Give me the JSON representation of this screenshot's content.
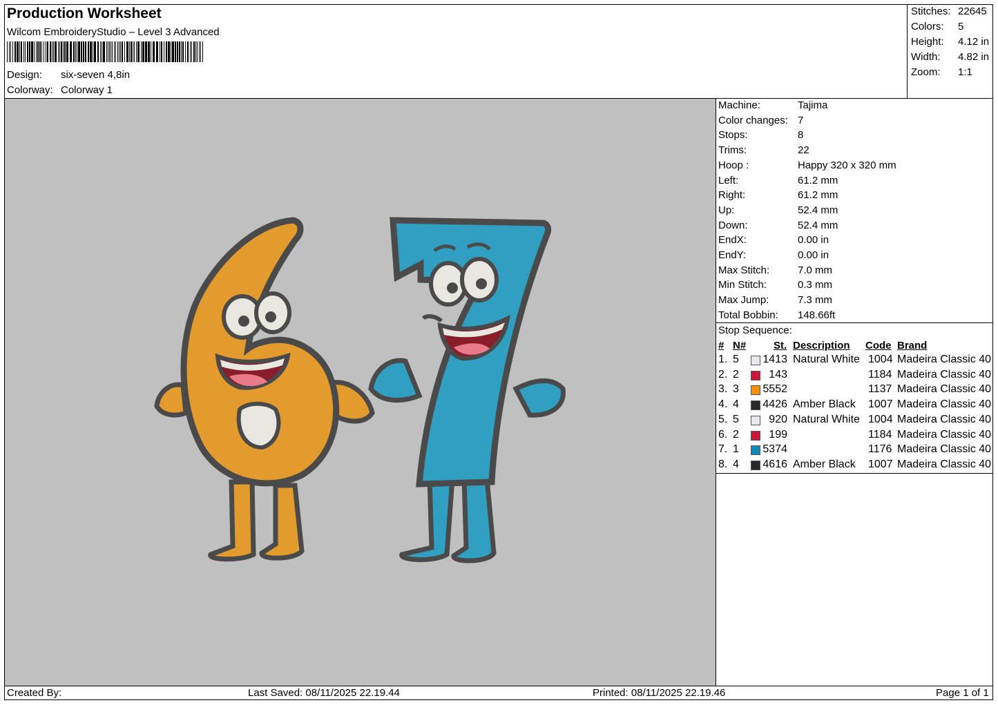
{
  "header": {
    "title": "Production Worksheet",
    "software": "Wilcom EmbroideryStudio – Level 3 Advanced",
    "design_label": "Design:",
    "design_value": "six-seven 4,8in",
    "colorway_label": "Colorway:",
    "colorway_value": "Colorway 1"
  },
  "summary": {
    "stitches_label": "Stitches:",
    "stitches_value": "22645",
    "colors_label": "Colors:",
    "colors_value": "5",
    "height_label": "Height:",
    "height_value": "4.12 in",
    "width_label": "Width:",
    "width_value": "4.82 in",
    "zoom_label": "Zoom:",
    "zoom_value": "1:1"
  },
  "machine_info": [
    {
      "label": "Machine:",
      "value": "Tajima"
    },
    {
      "label": "Color changes:",
      "value": "7"
    },
    {
      "label": "Stops:",
      "value": "8"
    },
    {
      "label": "Trims:",
      "value": "22"
    },
    {
      "label": "Hoop :",
      "value": "Happy 320 x 320 mm"
    },
    {
      "label": "Left:",
      "value": "61.2 mm"
    },
    {
      "label": "Right:",
      "value": "61.2 mm"
    },
    {
      "label": "Up:",
      "value": "52.4 mm"
    },
    {
      "label": "Down:",
      "value": "52.4 mm"
    },
    {
      "label": "EndX:",
      "value": "0.00 in"
    },
    {
      "label": "EndY:",
      "value": "0.00 in"
    },
    {
      "label": "Max Stitch:",
      "value": "7.0 mm"
    },
    {
      "label": "Min Stitch:",
      "value": "0.3 mm"
    },
    {
      "label": "Max Jump:",
      "value": "7.3 mm"
    },
    {
      "label": "Total Bobbin:",
      "value": "148.66ft"
    }
  ],
  "stop_sequence": {
    "title": "Stop Sequence:",
    "headers": {
      "num": "#",
      "n": "N#",
      "st": "St.",
      "description": "Description",
      "code": "Code",
      "brand": "Brand"
    },
    "rows": [
      {
        "num": "1.",
        "n": "5",
        "color": "#e8e8ee",
        "st": "1413",
        "description": "Natural White",
        "code": "1004",
        "brand": "Madeira Classic 40"
      },
      {
        "num": "2.",
        "n": "2",
        "color": "#c8183c",
        "st": "143",
        "description": "",
        "code": "1184",
        "brand": "Madeira Classic 40"
      },
      {
        "num": "3.",
        "n": "3",
        "color": "#f0900c",
        "st": "5552",
        "description": "",
        "code": "1137",
        "brand": "Madeira Classic 40"
      },
      {
        "num": "4.",
        "n": "4",
        "color": "#282828",
        "st": "4426",
        "description": "Amber Black",
        "code": "1007",
        "brand": "Madeira Classic 40"
      },
      {
        "num": "5.",
        "n": "5",
        "color": "#e8e8ee",
        "st": "920",
        "description": "Natural White",
        "code": "1004",
        "brand": "Madeira Classic 40"
      },
      {
        "num": "6.",
        "n": "2",
        "color": "#c8183c",
        "st": "199",
        "description": "",
        "code": "1184",
        "brand": "Madeira Classic 40"
      },
      {
        "num": "7.",
        "n": "1",
        "color": "#1488b8",
        "st": "5374",
        "description": "",
        "code": "1176",
        "brand": "Madeira Classic 40"
      },
      {
        "num": "8.",
        "n": "4",
        "color": "#282828",
        "st": "4616",
        "description": "Amber Black",
        "code": "1007",
        "brand": "Madeira Classic 40"
      }
    ]
  },
  "footer": {
    "created_by": "Created By:",
    "last_saved": "Last Saved: 08/11/2025 22.19.44",
    "printed": "Printed: 08/11/2025 22.19.46",
    "page": "Page 1 of 1"
  },
  "design_colors": {
    "background": "#c0c0c0",
    "six_fill": "#e39b2e",
    "seven_fill": "#2f9fc2",
    "outline": "#4a4a4a",
    "eye_white": "#e8e8e0",
    "mouth": "#8a1d2a",
    "tongue": "#e87a8a"
  }
}
